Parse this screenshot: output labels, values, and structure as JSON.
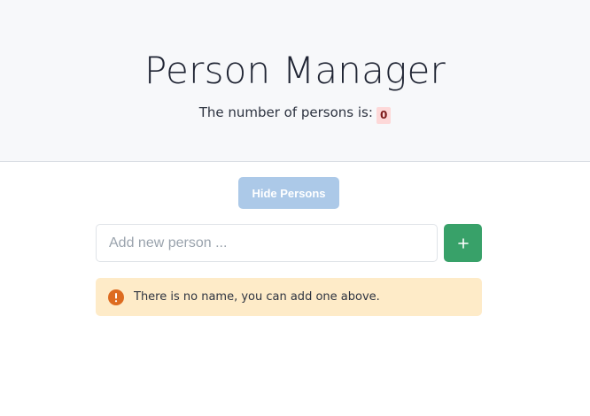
{
  "header": {
    "title": "Person Manager",
    "count_label": "The number of persons is:",
    "count_value": "0"
  },
  "toggle": {
    "label": "Hide Persons"
  },
  "add_form": {
    "placeholder": "Add new person ...",
    "value": "",
    "add_button_icon": "plus-icon"
  },
  "alert": {
    "icon": "exclamation-circle-icon",
    "message": "There is no name, you can add one above."
  },
  "colors": {
    "hero_bg": "#f7f8fa",
    "toggle_bg": "#acc9e8",
    "add_bg": "#38a169",
    "alert_bg": "#feebc8",
    "alert_icon": "#dd6b20",
    "badge_bg": "#fdd8d8"
  }
}
